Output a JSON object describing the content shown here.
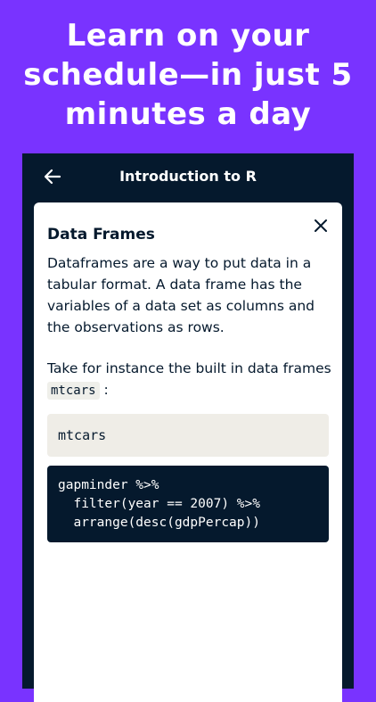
{
  "headline": {
    "lines": [
      "Learn on your",
      "schedule—in just 5",
      "minutes a day"
    ]
  },
  "app": {
    "title": "Introduction to R",
    "back_icon": "back-arrow-icon"
  },
  "card": {
    "close_icon": "close-icon",
    "title": "Data Frames",
    "paragraph1": "Dataframes are a way to put data in a tabular format. A data frame has the variables of a data set as columns and the observations as rows.",
    "paragraph2_prefix": "Take for instance the built in data frames",
    "paragraph2_code": "mtcars",
    "paragraph2_suffix": " :",
    "code_block_light": "mtcars",
    "code_block_dark": [
      "gapminder %>%",
      "  filter(year == 2007) %>%",
      "  arrange(desc(gdpPercap))"
    ]
  },
  "colors": {
    "background": "#7933ff",
    "app_dark": "#05192d",
    "card": "#ffffff",
    "code_light_bg": "#efede7"
  }
}
